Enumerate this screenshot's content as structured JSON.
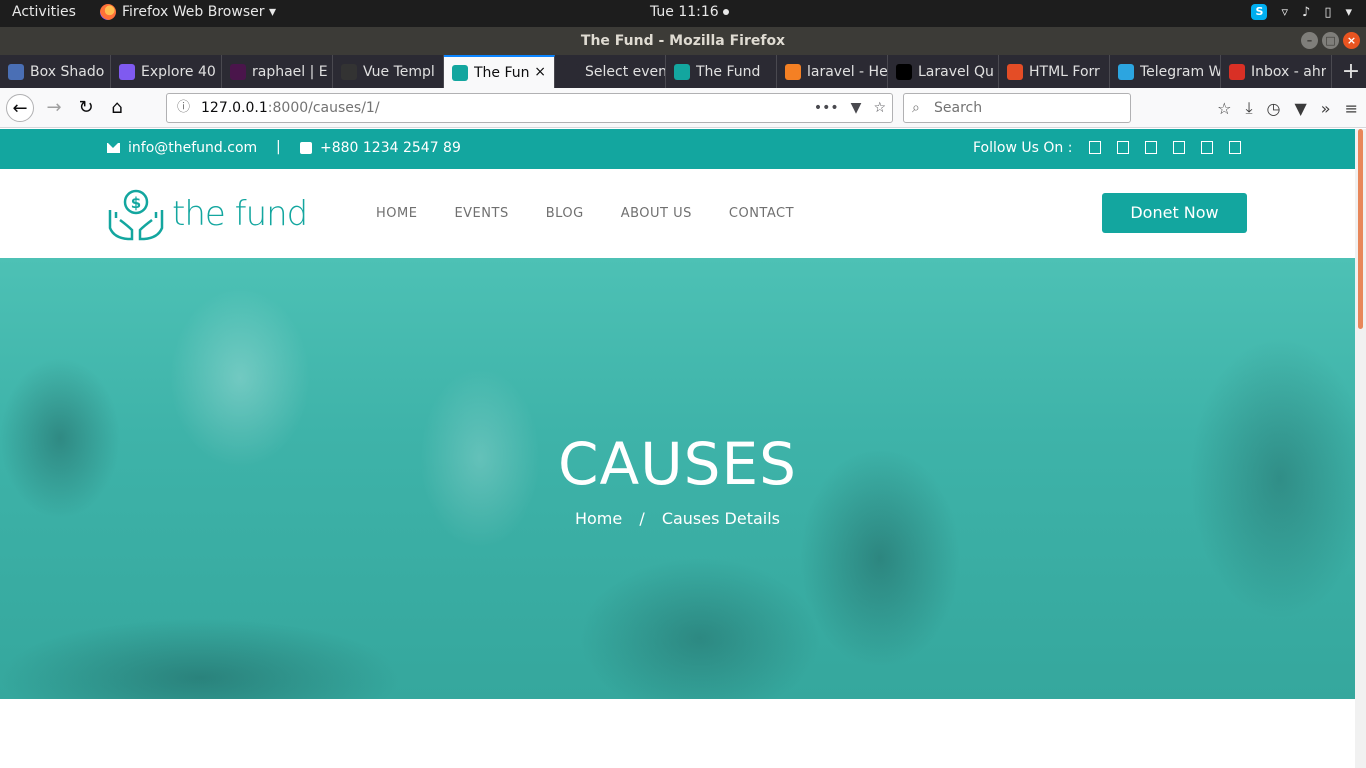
{
  "system_bar": {
    "activities": "Activities",
    "app_name": "Firefox Web Browser ▾",
    "clock": "Tue 11:16",
    "tray": {
      "skype": "S",
      "wifi": "▿",
      "volume": "♪",
      "battery": "▯",
      "menu": "▾"
    }
  },
  "window": {
    "title": "The Fund - Mozilla Firefox",
    "min": "–",
    "max": "□",
    "close": "×"
  },
  "tabs": [
    {
      "title": "Box Shado",
      "color": "#4a6fb5"
    },
    {
      "title": "Explore 40",
      "color": "#7f5af0"
    },
    {
      "title": "raphael | E",
      "color": "#4a154b"
    },
    {
      "title": "Vue Templ",
      "color": "#333333"
    },
    {
      "title": "The Fun",
      "color": "#13a69f",
      "active": true,
      "close": "×"
    },
    {
      "title": "Select event t",
      "color": "#2b2a33"
    },
    {
      "title": "The Fund",
      "color": "#13a69f"
    },
    {
      "title": "laravel - He",
      "color": "#f48024"
    },
    {
      "title": "Laravel Qu",
      "color": "#000000"
    },
    {
      "title": "HTML Forr",
      "color": "#e44d26"
    },
    {
      "title": "Telegram W",
      "color": "#2ca5e0"
    },
    {
      "title": "Inbox - ahr",
      "color": "#d93025"
    }
  ],
  "new_tab": "+",
  "nav": {
    "back": "←",
    "forward": "→",
    "reload": "↻",
    "home": "⌂",
    "info": "ⓘ",
    "url_host": "127.0.0.1",
    "url_path": ":8000/causes/1/",
    "page_actions": "•••",
    "pocket": "▼",
    "bookmark": "☆",
    "search_placeholder": "Search",
    "search_icon": "⌕",
    "tools": {
      "library": "☆",
      "downloads": "⤓",
      "history": "◷",
      "ext": "▼",
      "overflow": "»",
      "menu": "≡"
    }
  },
  "site": {
    "email": "info@thefund.com",
    "separator": "|",
    "phone": "+880 1234 2547 89",
    "follow_label": "Follow Us On :",
    "logo_text": "the fund",
    "menu": [
      "HOME",
      "EVENTS",
      "BLOG",
      "ABOUT US",
      "CONTACT"
    ],
    "donate_label": "Donet Now",
    "hero_title": "CAUSES",
    "breadcrumb": {
      "home": "Home",
      "sep": "/",
      "current": "Causes Details"
    },
    "brand_color": "#13a69f"
  }
}
